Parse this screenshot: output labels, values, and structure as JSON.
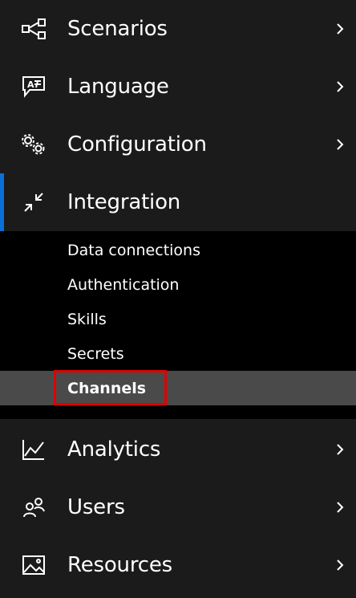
{
  "nav": {
    "items": [
      {
        "label": "Scenarios",
        "icon": "share-node-icon",
        "chevron": "›"
      },
      {
        "label": "Language",
        "icon": "chat-text-icon",
        "chevron": "›"
      },
      {
        "label": "Configuration",
        "icon": "gears-icon",
        "chevron": "›"
      },
      {
        "label": "Integration",
        "icon": "collapse-arrows-icon",
        "expanded": true
      },
      {
        "label": "Analytics",
        "icon": "line-chart-icon",
        "chevron": "›"
      },
      {
        "label": "Users",
        "icon": "users-icon",
        "chevron": "›"
      },
      {
        "label": "Resources",
        "icon": "image-icon",
        "chevron": "›"
      }
    ],
    "integration_subitems": [
      {
        "label": "Data connections"
      },
      {
        "label": "Authentication"
      },
      {
        "label": "Skills"
      },
      {
        "label": "Secrets"
      },
      {
        "label": "Channels",
        "active": true
      }
    ]
  },
  "colors": {
    "background": "#1b1b1b",
    "submenu_background": "#000000",
    "active_item_background": "#4a4a4a",
    "accent": "#0a70d8",
    "highlight_border": "#e00000",
    "text": "#ffffff"
  }
}
